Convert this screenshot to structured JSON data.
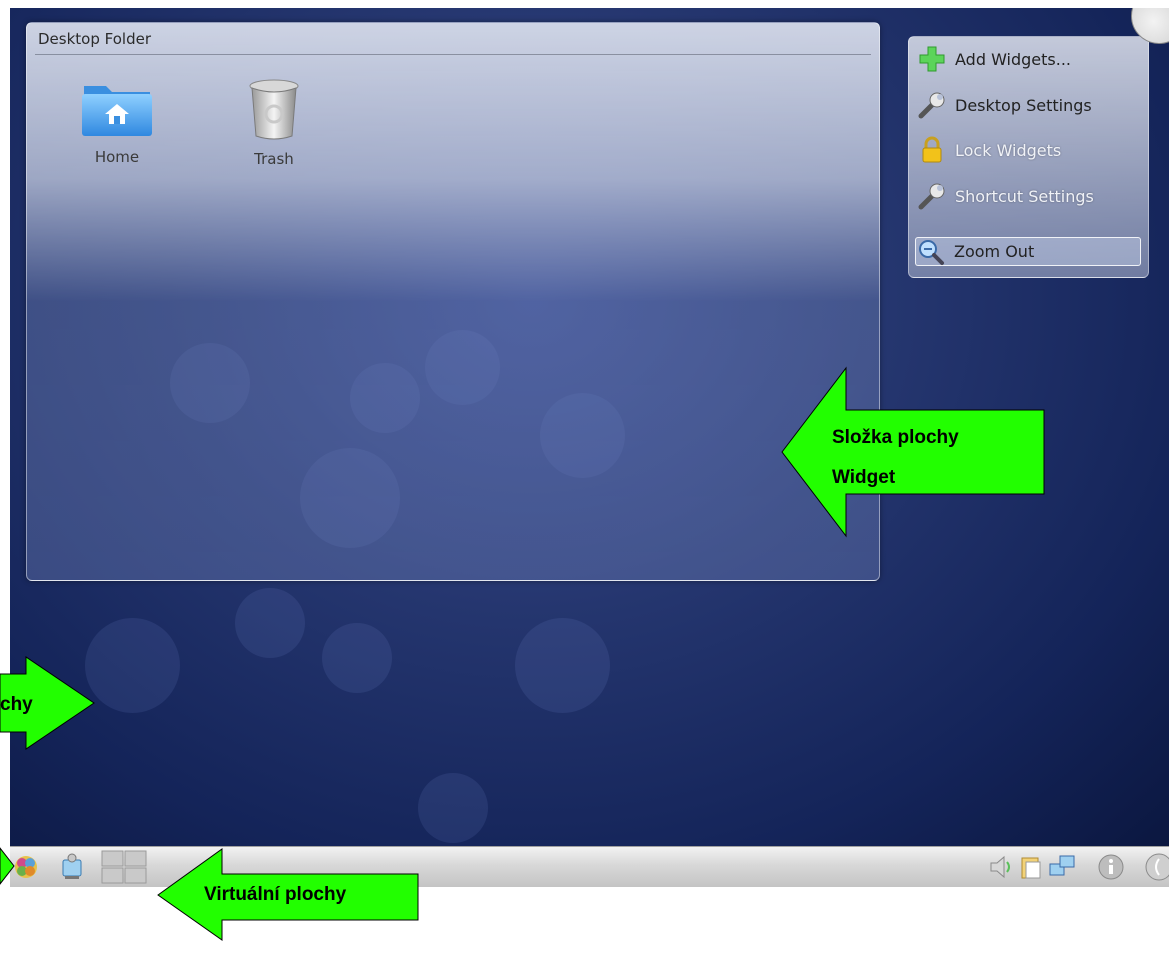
{
  "desktop_folder": {
    "title": "Desktop Folder",
    "icons": [
      {
        "label": "Home",
        "icon": "home-folder-icon"
      },
      {
        "label": "Trash",
        "icon": "trash-icon"
      }
    ]
  },
  "toolbox": {
    "items": [
      {
        "label": "Add Widgets...",
        "icon": "plus-icon",
        "state": "normal"
      },
      {
        "label": "Desktop Settings",
        "icon": "wrench-icon",
        "state": "normal"
      },
      {
        "label": "Lock Widgets",
        "icon": "lock-icon",
        "state": "disabled"
      },
      {
        "label": "Shortcut Settings",
        "icon": "wrench-icon",
        "state": "disabled"
      },
      {
        "label": "Zoom Out",
        "icon": "zoom-out-icon",
        "state": "selected"
      }
    ]
  },
  "annotations": {
    "folder_widget_line1": "Složka plochy",
    "folder_widget_line2": "Widget",
    "left_partial": "chy",
    "virtual_desktops": "Virtuální plochy"
  },
  "panel": {
    "left_icons": [
      "kde-menu-icon",
      "network-icon",
      "pager-icon"
    ],
    "tray_icons": [
      "volume-icon",
      "clipboard-icon",
      "network-tray-icon",
      "info-icon",
      "cashew-icon"
    ]
  },
  "colors": {
    "arrow_fill": "#22ff00",
    "desktop_dark": "#0b1740",
    "desktop_light": "#3c4f95"
  }
}
